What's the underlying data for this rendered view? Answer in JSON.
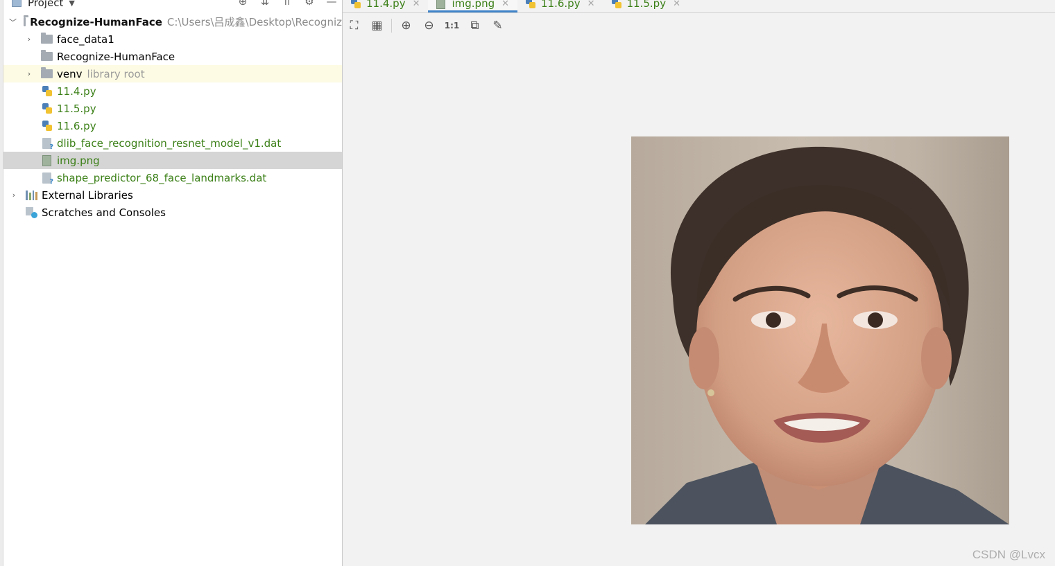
{
  "project_panel": {
    "title": "Project",
    "root": {
      "name": "Recognize-HumanFace",
      "path": "C:\\Users\\吕成鑫\\Desktop\\Recogniz"
    },
    "items": [
      {
        "label": "face_data1"
      },
      {
        "label": "Recognize-HumanFace"
      },
      {
        "label": "venv",
        "hint": "library root"
      },
      {
        "label": "11.4.py"
      },
      {
        "label": "11.5.py"
      },
      {
        "label": "11.6.py"
      },
      {
        "label": "dlib_face_recognition_resnet_model_v1.dat"
      },
      {
        "label": "img.png"
      },
      {
        "label": "shape_predictor_68_face_landmarks.dat"
      }
    ],
    "external_libraries": "External Libraries",
    "scratches": "Scratches and Consoles"
  },
  "tabs": [
    {
      "label": "11.4.py"
    },
    {
      "label": "img.png"
    },
    {
      "label": "11.6.py"
    },
    {
      "label": "11.5.py"
    }
  ],
  "image_toolbar": {
    "actual_size_label": "1:1"
  },
  "watermark": "CSDN @Lvcx",
  "colors": {
    "accent": "#4083c9",
    "file_green": "#3a7f16",
    "highlight_row": "#fdfbe3",
    "selected_row": "#d5d5d5"
  }
}
